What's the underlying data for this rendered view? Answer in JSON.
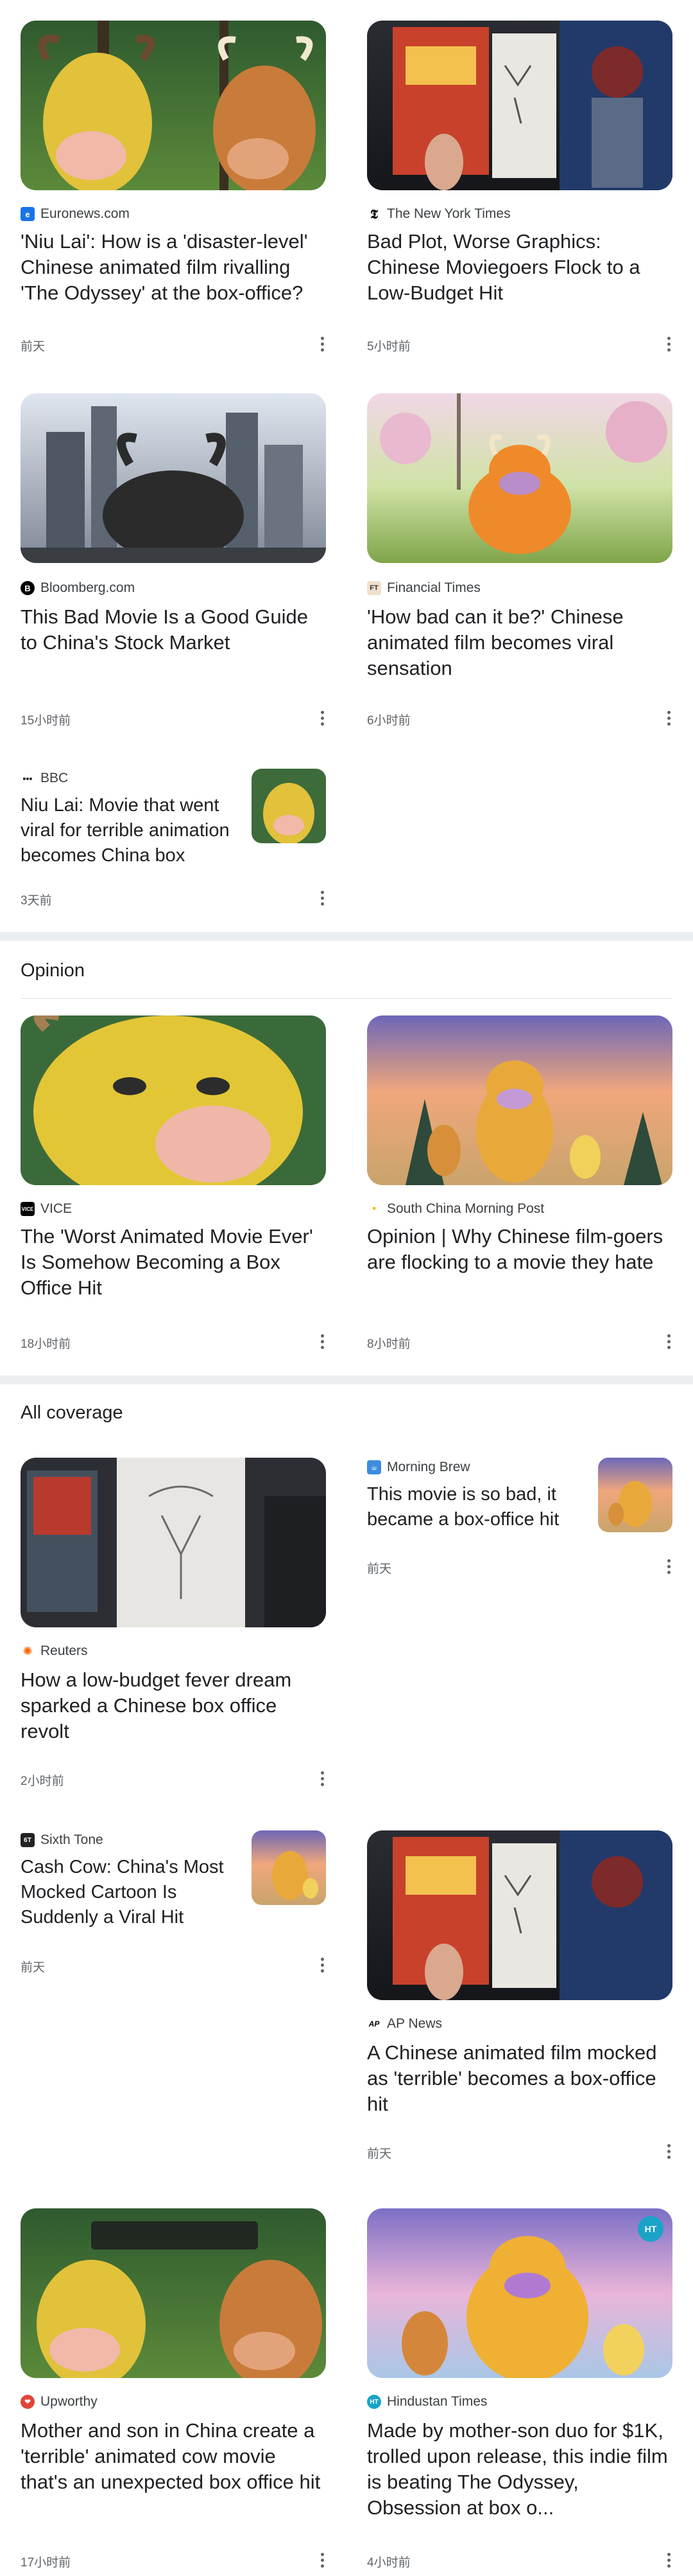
{
  "colors": {
    "divider": "#eceff1",
    "text": "#202124",
    "meta": "#5f6368"
  },
  "top_articles": [
    {
      "source": "Euronews.com",
      "source_icon": "euronews-logo-icon",
      "title": "'Niu Lai': How is a 'disaster-level' Chinese animated film rivalling 'The Odyssey' at the box-office?",
      "time": "前天"
    },
    {
      "source": "The New York Times",
      "source_icon": "nyt-logo-icon",
      "title": "Bad Plot, Worse Graphics: Chinese Moviegoers Flock to a Low-Budget Hit",
      "time": "5小时前"
    },
    {
      "source": "Bloomberg.com",
      "source_icon": "bloomberg-logo-icon",
      "title": "This Bad Movie Is a Good Guide to China's Stock Market",
      "time": "15小时前"
    },
    {
      "source": "Financial Times",
      "source_icon": "ft-logo-icon",
      "title": "'How bad can it be?' Chinese animated film becomes viral sensation",
      "time": "6小时前"
    },
    {
      "source": "BBC",
      "source_icon": "bbc-logo-icon",
      "title": "Niu Lai: Movie that went viral for terrible animation becomes China box offic...",
      "time": "3天前"
    }
  ],
  "opinion": {
    "heading": "Opinion",
    "articles": [
      {
        "source": "VICE",
        "source_icon": "vice-logo-icon",
        "title": "The 'Worst Animated Movie Ever' Is Somehow Becoming a Box Office Hit",
        "time": "18小时前"
      },
      {
        "source": "South China Morning Post",
        "source_icon": "scmp-logo-icon",
        "title": "Opinion | Why Chinese film-goers are flocking to a movie they hate",
        "time": "8小时前"
      }
    ]
  },
  "all_coverage": {
    "heading": "All coverage",
    "articles": [
      {
        "source": "Reuters",
        "source_icon": "reuters-logo-icon",
        "title": "How a low-budget fever dream sparked a Chinese box office revolt",
        "time": "2小时前"
      },
      {
        "source": "Morning Brew",
        "source_icon": "morning-brew-logo-icon",
        "title": "This movie is so bad, it became a box-office hit",
        "time": "前天"
      },
      {
        "source": "Sixth Tone",
        "source_icon": "sixth-tone-logo-icon",
        "title": "Cash Cow: China's Most Mocked Cartoon Is Suddenly a Viral Hit",
        "time": "前天"
      },
      {
        "source": "AP News",
        "source_icon": "ap-logo-icon",
        "title": "A Chinese animated film mocked as 'terrible' becomes a box-office hit",
        "time": "前天"
      },
      {
        "source": "Upworthy",
        "source_icon": "upworthy-logo-icon",
        "title": "Mother and son in China create a 'terrible' animated cow movie that's an unexpected box office hit",
        "time": "17小时前"
      },
      {
        "source": "Hindustan Times",
        "source_icon": "hindustan-times-logo-icon",
        "title": "Made by mother-son duo for $1K, trolled upon release, this indie film is beating The Odyssey, Obsession at box o...",
        "time": "4小时前"
      }
    ]
  },
  "badges": {
    "ht_badge": "HT"
  }
}
